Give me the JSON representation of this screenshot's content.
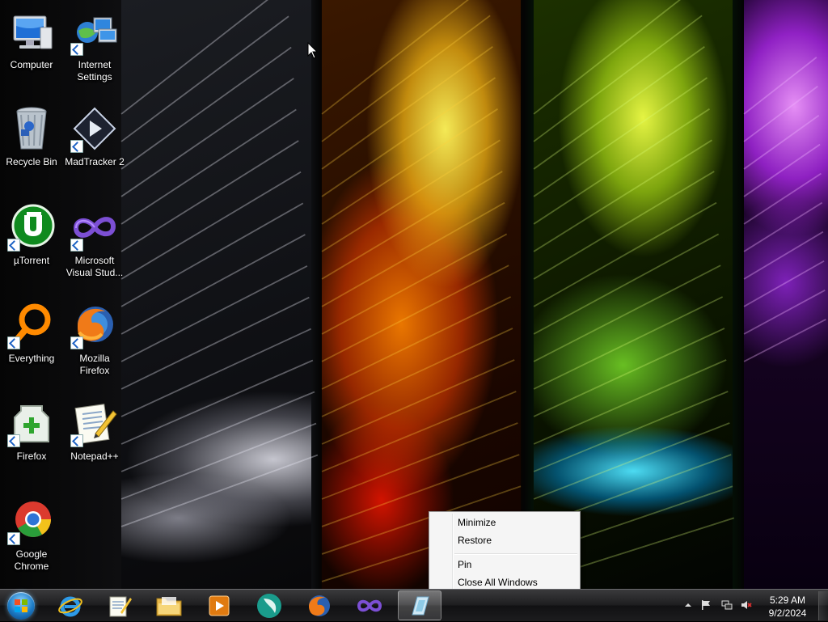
{
  "desktop": {
    "icons": [
      {
        "label": "Computer",
        "shortcut": false
      },
      {
        "label": "Internet\nSettings",
        "shortcut": true
      },
      {
        "label": "Recycle Bin",
        "shortcut": false
      },
      {
        "label": "MadTracker 2",
        "shortcut": true
      },
      {
        "label": "µTorrent",
        "shortcut": true
      },
      {
        "label": "Microsoft\nVisual Stud...",
        "shortcut": true
      },
      {
        "label": "Everything",
        "shortcut": true
      },
      {
        "label": "Mozilla\nFirefox",
        "shortcut": true
      },
      {
        "label": "Firefox",
        "shortcut": true
      },
      {
        "label": "Notepad++",
        "shortcut": true
      },
      {
        "label": "Google\nChrome",
        "shortcut": true
      }
    ]
  },
  "context_menu": {
    "items": [
      "Minimize",
      "Restore",
      "Pin",
      "Close All Windows"
    ]
  },
  "taskbar": {
    "pinned": [
      {
        "icon": "internet-explorer-icon"
      },
      {
        "icon": "notepad-icon"
      },
      {
        "icon": "file-explorer-icon"
      },
      {
        "icon": "media-player-icon"
      },
      {
        "icon": "madtracker-icon"
      },
      {
        "icon": "firefox-icon"
      },
      {
        "icon": "visual-studio-icon"
      },
      {
        "icon": "active-window-icon"
      }
    ],
    "clock": {
      "time": "5:29 AM",
      "date": "9/2/2024"
    },
    "tray_icons": [
      "tray-expand-icon",
      "action-center-flag-icon",
      "network-icon",
      "volume-muted-icon"
    ]
  }
}
